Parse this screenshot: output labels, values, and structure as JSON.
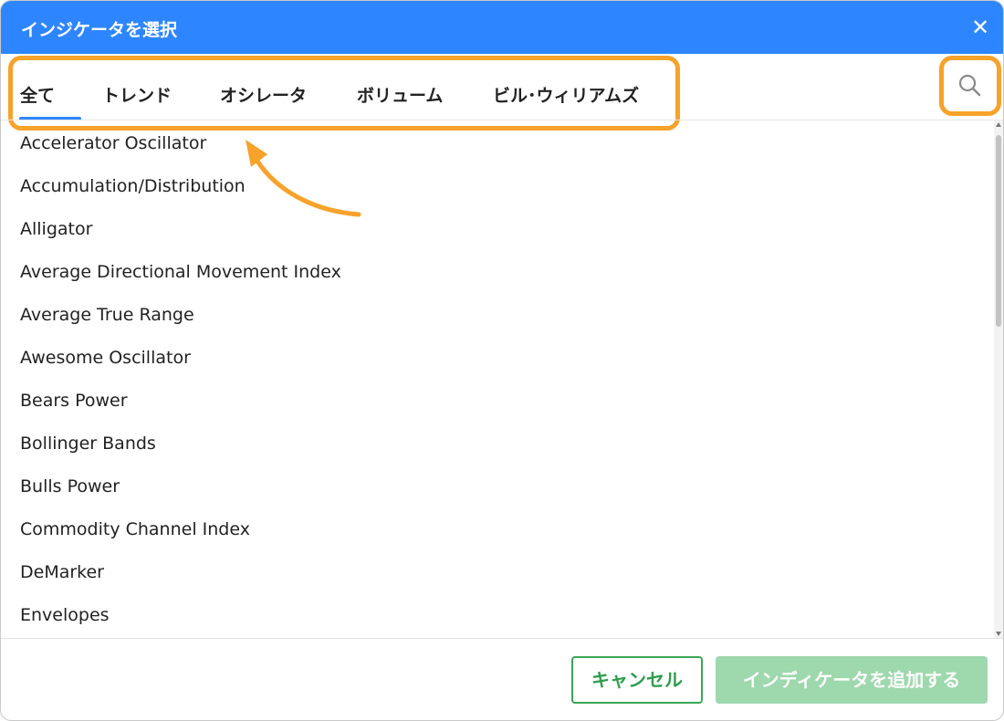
{
  "dialog": {
    "title": "インジケータを選択",
    "close_icon": "close-icon"
  },
  "tabs": [
    {
      "label": "全て",
      "active": true
    },
    {
      "label": "トレンド",
      "active": false
    },
    {
      "label": "オシレータ",
      "active": false
    },
    {
      "label": "ボリューム",
      "active": false
    },
    {
      "label": "ビル･ウィリアムズ",
      "active": false
    }
  ],
  "search": {
    "icon": "search-icon"
  },
  "indicators": [
    "Accelerator Oscillator",
    "Accumulation/Distribution",
    "Alligator",
    "Average Directional Movement Index",
    "Average True Range",
    "Awesome Oscillator",
    "Bears Power",
    "Bollinger Bands",
    "Bulls Power",
    "Commodity Channel Index",
    "DeMarker",
    "Envelopes"
  ],
  "footer": {
    "cancel_label": "キャンセル",
    "add_label": "インディケータを追加する"
  },
  "colors": {
    "title_bar": "#2d86ff",
    "highlight": "#f7a22a",
    "tab_underline": "#2d86ff",
    "cancel": "#3aa655",
    "add_disabled": "#9ed8ad"
  }
}
